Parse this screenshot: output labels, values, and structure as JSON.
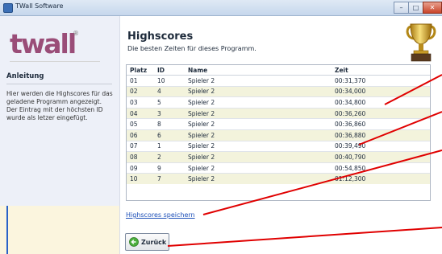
{
  "window": {
    "title": "TWall Software",
    "buttons": {
      "minimize": "–",
      "maximize": "□",
      "close": "✕"
    }
  },
  "sidebar": {
    "logo_text": "twall",
    "logo_mark": "®",
    "heading": "Anleitung",
    "text": "Hier werden die Highscores für das geladene Programm angezeigt. Der Eintrag mit der höchsten ID wurde als letzer eingefügt."
  },
  "main": {
    "title": "Highscores",
    "subtitle": "Die besten Zeiten für dieses Programm.",
    "icon": "trophy-icon"
  },
  "table": {
    "columns": [
      "Platz",
      "ID",
      "Name",
      "Zeit"
    ],
    "rows": [
      [
        "01",
        "10",
        "Spieler 2",
        "00:31,370"
      ],
      [
        "02",
        "4",
        "Spieler 2",
        "00:34,000"
      ],
      [
        "03",
        "5",
        "Spieler 2",
        "00:34,800"
      ],
      [
        "04",
        "3",
        "Spieler 2",
        "00:36,260"
      ],
      [
        "05",
        "8",
        "Spieler 2",
        "00:36,860"
      ],
      [
        "06",
        "6",
        "Spieler 2",
        "00:36,880"
      ],
      [
        "07",
        "1",
        "Spieler 2",
        "00:39,490"
      ],
      [
        "08",
        "2",
        "Spieler 2",
        "00:40,790"
      ],
      [
        "09",
        "9",
        "Spieler 2",
        "00:54,850"
      ],
      [
        "10",
        "7",
        "Spieler 2",
        "01:12,300"
      ]
    ]
  },
  "actions": {
    "save_link": "Highscores speichern",
    "back_button": "Zurück"
  },
  "colors": {
    "logo": "#9a4d78",
    "annotation": "#e00000",
    "link": "#1c4fb8",
    "row_alt": "#f3f3dc"
  }
}
